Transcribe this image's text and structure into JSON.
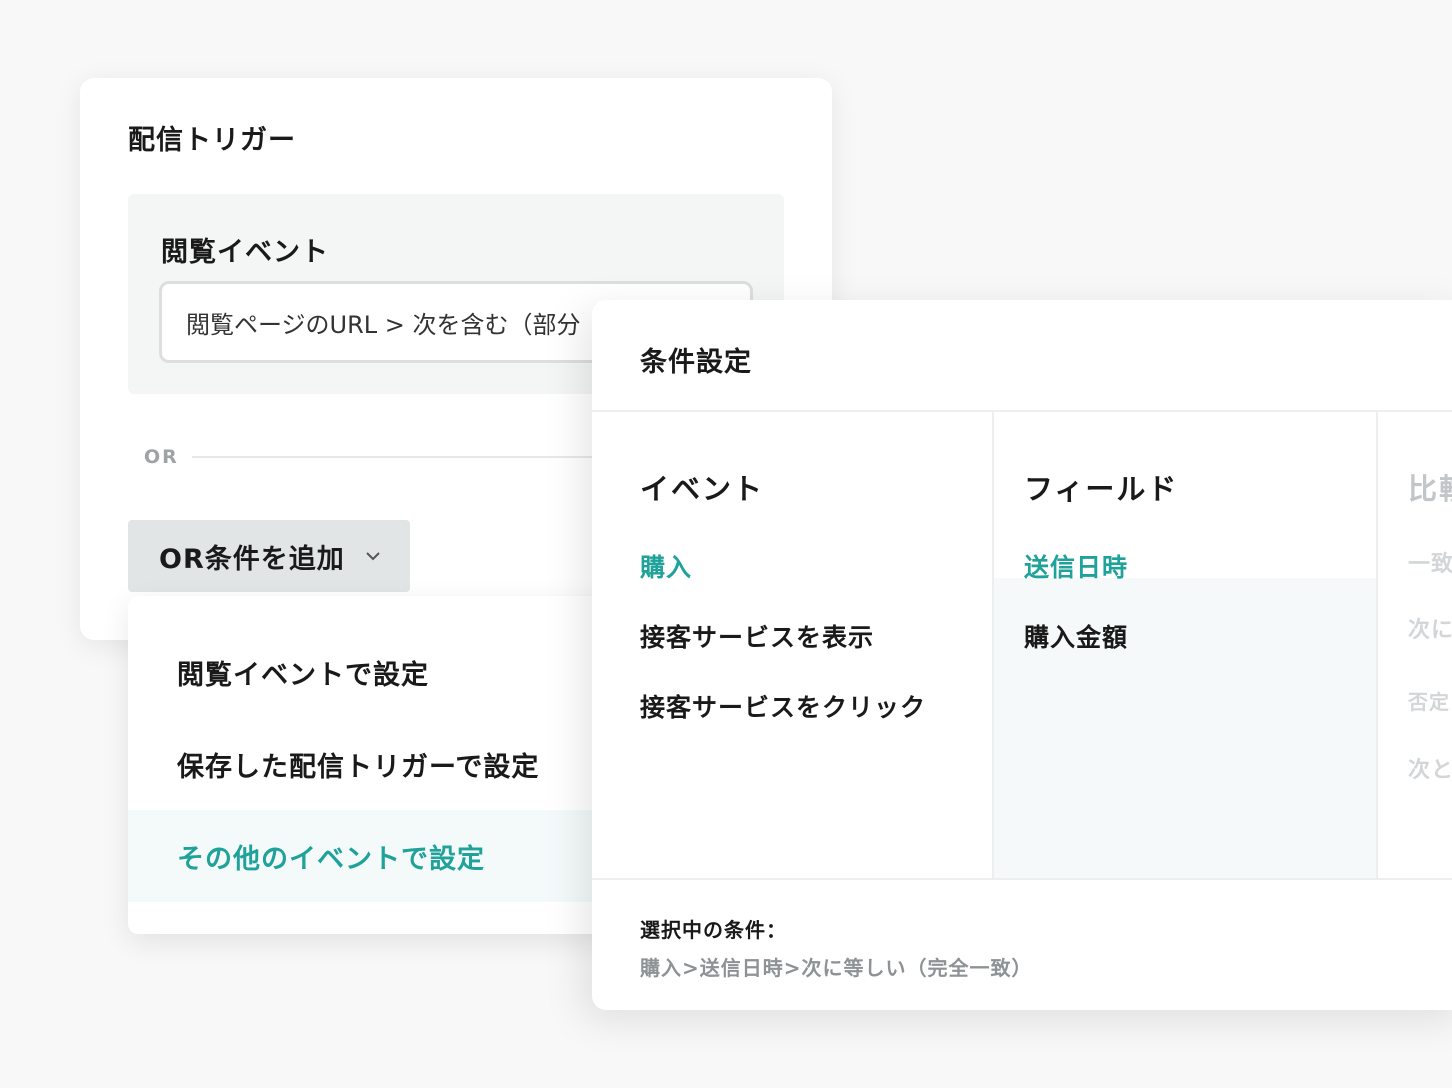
{
  "trigger_card": {
    "title": "配信トリガー",
    "event_label": "閲覧イベント",
    "event_input_value": "閲覧ページのURL > 次を含む（部分",
    "or_label": "OR",
    "add_or_button": "OR条件を追加"
  },
  "dropdown": {
    "items": [
      {
        "label": "閲覧イベントで設定"
      },
      {
        "label": "保存した配信トリガーで設定"
      },
      {
        "label": "その他のイベントで設定"
      }
    ]
  },
  "condition_panel": {
    "title": "条件設定",
    "event_column": {
      "header": "イベント",
      "items": [
        "購入",
        "接客サービスを表示",
        "接客サービスをクリック"
      ]
    },
    "field_column": {
      "header": "フィールド",
      "items": [
        "送信日時",
        "購入金額"
      ]
    },
    "compare_column": {
      "header": "比較",
      "items": [
        "一致",
        "次に",
        "否定",
        "次と"
      ]
    },
    "selected_label": "選択中の条件：",
    "selected_value": "購入>送信日時>次に等しい（完全一致）"
  },
  "colors": {
    "accent": "#1fa29a",
    "background": "#f8f8f8",
    "button_bg": "#e2e5e6"
  }
}
